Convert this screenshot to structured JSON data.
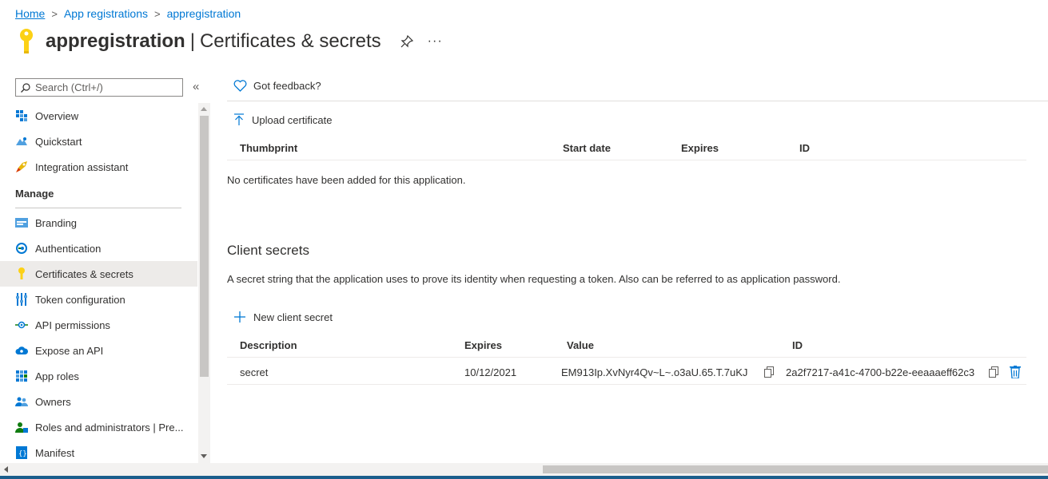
{
  "breadcrumb": {
    "home": "Home",
    "app_registrations": "App registrations",
    "current": "appregistration",
    "separator": ">"
  },
  "header": {
    "app_name": "appregistration",
    "separator": "|",
    "page_title": "Certificates & secrets",
    "more_label": "···"
  },
  "sidebar": {
    "search_placeholder": "Search (Ctrl+/)",
    "collapse_label": "«",
    "items_top": [
      {
        "label": "Overview",
        "icon": "overview-icon"
      },
      {
        "label": "Quickstart",
        "icon": "quickstart-icon"
      },
      {
        "label": "Integration assistant",
        "icon": "rocket-icon"
      }
    ],
    "manage_header": "Manage",
    "items_manage": [
      {
        "label": "Branding",
        "icon": "branding-icon"
      },
      {
        "label": "Authentication",
        "icon": "authentication-icon"
      },
      {
        "label": "Certificates & secrets",
        "icon": "key-icon",
        "active": true
      },
      {
        "label": "Token configuration",
        "icon": "token-icon"
      },
      {
        "label": "API permissions",
        "icon": "api-permissions-icon"
      },
      {
        "label": "Expose an API",
        "icon": "cloud-icon"
      },
      {
        "label": "App roles",
        "icon": "app-roles-icon"
      },
      {
        "label": "Owners",
        "icon": "owners-icon"
      },
      {
        "label": "Roles and administrators | Pre...",
        "icon": "roles-icon"
      },
      {
        "label": "Manifest",
        "icon": "manifest-icon"
      }
    ]
  },
  "main": {
    "feedback": "Got feedback?",
    "certificates": {
      "upload_label": "Upload certificate",
      "columns": [
        "Thumbprint",
        "Start date",
        "Expires",
        "ID"
      ],
      "empty_message": "No certificates have been added for this application."
    },
    "client_secrets": {
      "title": "Client secrets",
      "description": "A secret string that the application uses to prove its identity when requesting a token. Also can be referred to as application password.",
      "new_label": "New client secret",
      "columns": [
        "Description",
        "Expires",
        "Value",
        "ID"
      ],
      "rows": [
        {
          "description": "secret",
          "expires": "10/12/2021",
          "value": "EM913Ip.XvNyr4Qv~L~.o3aU.65.T.7uKJ",
          "id": "2a2f7217-a41c-4700-b22e-eeaaaeff62c3"
        }
      ]
    }
  },
  "colors": {
    "accent": "#0078d4",
    "key_yellow": "#fcd116",
    "active_bg": "#edebe9"
  }
}
